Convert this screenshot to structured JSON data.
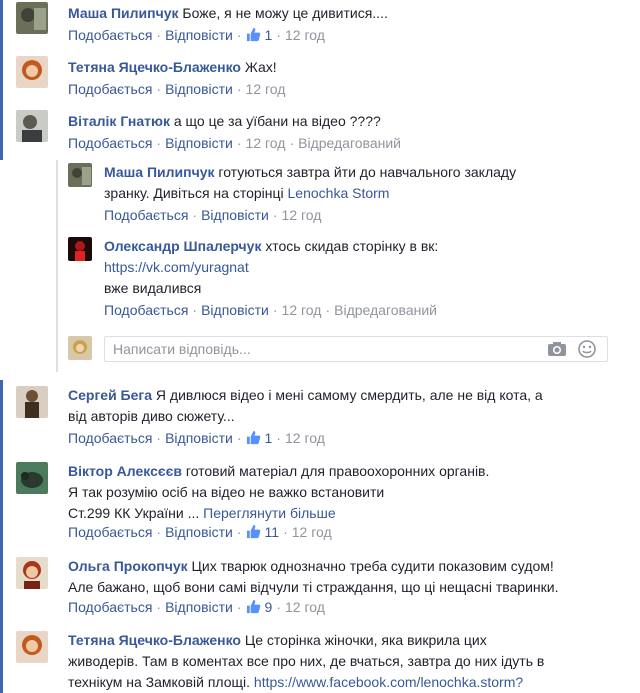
{
  "labels": {
    "like": "Подобається",
    "reply": "Відповісти",
    "edited": "Відредагований",
    "see_more": "Переглянути більше"
  },
  "comments": [
    {
      "author": "Маша Пилипчук",
      "text": "Боже, я не можу це дивитися....",
      "likes": "1",
      "time": "12 год"
    },
    {
      "author": "Тетяна Яцечко-Блаженко",
      "text": "Жах!",
      "time": "12 год"
    },
    {
      "author": "Віталік Гнатюк",
      "text": "а що це за уїбани на відео ????",
      "time": "12 год"
    },
    {
      "author": "Сергей Бега",
      "text": "Я дивлюся відео і мені самому смердить, але не від кота, а",
      "text2": "від авторів диво сюжету...",
      "likes": "1",
      "time": "12 год"
    },
    {
      "author": "Віктор Алексєєв",
      "text": "готовий матеріал для правоохоронних органів.",
      "text2": "Я так розумію осіб на відео не важко встановити",
      "text3": "Ст.299 КК України ...",
      "likes": "11",
      "time": "12 год"
    },
    {
      "author": "Ольга Прокопчук",
      "text": "Цих тварюк однозначно треба судити показовим судом!",
      "text2": "Але бажано, щоб вони самі відчули ті страждання, що ці нещасні тваринки.",
      "likes": "9",
      "time": "12 год"
    },
    {
      "author": "Тетяна Яцечко-Блаженко",
      "text": "Це сторінка жіночки, яка викрила цих",
      "text2": "живодерів. Там в коментах все про них, де вчаться, завтра до них ідуть в",
      "text3": "технікум на Замковій площі.",
      "link": "https://www.facebook.com/lenochka.storm?"
    }
  ],
  "replies": [
    {
      "author": "Маша Пилипчук",
      "text": "готуються завтра йти до навчального закладу",
      "text2": "зранку. Дивіться на сторінці",
      "link": "Lenochka Storm",
      "time": "12 год"
    },
    {
      "author": "Олександр Шпалерчук",
      "text": "хтось скидав сторінку в вк:",
      "link": "https://vk.com/yuragnat",
      "text2": "вже видалився",
      "time": "12 год"
    }
  ],
  "reply_input": {
    "placeholder": "Написати відповідь..."
  },
  "colors": {
    "accent": "#4267b2",
    "name": "#385898",
    "muted": "#90949c"
  }
}
